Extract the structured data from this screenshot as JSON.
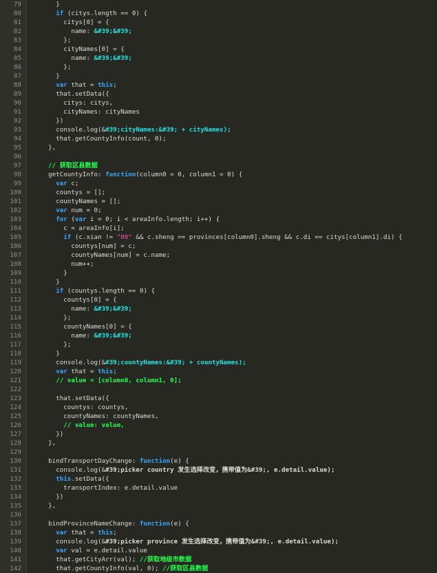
{
  "editor": {
    "colors": {
      "background": "#272822",
      "gutter": "#2f302a",
      "line_number": "#8f908a",
      "plain": "#dcdcd4",
      "keyword": "#3aa7ff",
      "string": "#1ee3e3",
      "number": "#ff4fb0",
      "comment": "#20ff4f"
    },
    "lines": [
      {
        "n": "79",
        "tokens": [
          {
            "t": "      }",
            "c": "pl"
          }
        ]
      },
      {
        "n": "80",
        "tokens": [
          {
            "t": "      ",
            "c": "pl"
          },
          {
            "t": "if",
            "c": "kw"
          },
          {
            "t": " (citys.length == 0) {",
            "c": "pl"
          }
        ]
      },
      {
        "n": "81",
        "tokens": [
          {
            "t": "        citys[0] = {",
            "c": "pl"
          }
        ]
      },
      {
        "n": "82",
        "tokens": [
          {
            "t": "          name: ",
            "c": "pl"
          },
          {
            "t": "&#39;&#39;",
            "c": "str"
          }
        ]
      },
      {
        "n": "83",
        "tokens": [
          {
            "t": "        };",
            "c": "pl"
          }
        ]
      },
      {
        "n": "84",
        "tokens": [
          {
            "t": "        cityNames[0] = {",
            "c": "pl"
          }
        ]
      },
      {
        "n": "85",
        "tokens": [
          {
            "t": "          name: ",
            "c": "pl"
          },
          {
            "t": "&#39;&#39;",
            "c": "str"
          }
        ]
      },
      {
        "n": "86",
        "tokens": [
          {
            "t": "        };",
            "c": "pl"
          }
        ]
      },
      {
        "n": "87",
        "tokens": [
          {
            "t": "      }",
            "c": "pl"
          }
        ]
      },
      {
        "n": "88",
        "tokens": [
          {
            "t": "      ",
            "c": "pl"
          },
          {
            "t": "var",
            "c": "kw"
          },
          {
            "t": " that = ",
            "c": "pl"
          },
          {
            "t": "this",
            "c": "kw"
          },
          {
            "t": ";",
            "c": "pl"
          }
        ]
      },
      {
        "n": "89",
        "tokens": [
          {
            "t": "      that.setData({",
            "c": "pl"
          }
        ]
      },
      {
        "n": "90",
        "tokens": [
          {
            "t": "        citys: citys,",
            "c": "pl"
          }
        ]
      },
      {
        "n": "91",
        "tokens": [
          {
            "t": "        cityNames: cityNames",
            "c": "pl"
          }
        ]
      },
      {
        "n": "92",
        "tokens": [
          {
            "t": "      })",
            "c": "pl"
          }
        ]
      },
      {
        "n": "93",
        "tokens": [
          {
            "t": "      console.log(&",
            "c": "pl"
          },
          {
            "t": "#39;cityNames:&#39; + cityNames);",
            "c": "str"
          }
        ]
      },
      {
        "n": "94",
        "tokens": [
          {
            "t": "      that.getCountyInfo(count, 0);",
            "c": "pl"
          }
        ]
      },
      {
        "n": "95",
        "tokens": [
          {
            "t": "    },",
            "c": "pl"
          }
        ]
      },
      {
        "n": "96",
        "tokens": [
          {
            "t": "",
            "c": "pl"
          }
        ]
      },
      {
        "n": "97",
        "tokens": [
          {
            "t": "    ",
            "c": "pl"
          },
          {
            "t": "// 获取区县数据",
            "c": "cm"
          }
        ]
      },
      {
        "n": "98",
        "tokens": [
          {
            "t": "    getCountyInfo: ",
            "c": "pl"
          },
          {
            "t": "function",
            "c": "kw"
          },
          {
            "t": "(column0 = 0, column1 = 0) {",
            "c": "pl"
          }
        ]
      },
      {
        "n": "99",
        "tokens": [
          {
            "t": "      ",
            "c": "pl"
          },
          {
            "t": "var",
            "c": "kw"
          },
          {
            "t": " c;",
            "c": "pl"
          }
        ]
      },
      {
        "n": "100",
        "tokens": [
          {
            "t": "      countys = [];",
            "c": "pl"
          }
        ]
      },
      {
        "n": "101",
        "tokens": [
          {
            "t": "      countyNames = [];",
            "c": "pl"
          }
        ]
      },
      {
        "n": "102",
        "tokens": [
          {
            "t": "      ",
            "c": "pl"
          },
          {
            "t": "var",
            "c": "kw"
          },
          {
            "t": " num = 0;",
            "c": "pl"
          }
        ]
      },
      {
        "n": "103",
        "tokens": [
          {
            "t": "      ",
            "c": "pl"
          },
          {
            "t": "for",
            "c": "kw"
          },
          {
            "t": " (",
            "c": "pl"
          },
          {
            "t": "var",
            "c": "kw"
          },
          {
            "t": " i = 0; i < areaInfo.length; i++) {",
            "c": "pl"
          }
        ]
      },
      {
        "n": "104",
        "tokens": [
          {
            "t": "        c = areaInfo[i];",
            "c": "pl"
          }
        ]
      },
      {
        "n": "105",
        "tokens": [
          {
            "t": "        ",
            "c": "pl"
          },
          {
            "t": "if",
            "c": "kw"
          },
          {
            "t": " (c.xian != ",
            "c": "pl"
          },
          {
            "t": "\"00\"",
            "c": "num"
          },
          {
            "t": " && c.sheng == provinces[column0].sheng && c.di == citys[column1].di) {",
            "c": "pl"
          }
        ]
      },
      {
        "n": "106",
        "tokens": [
          {
            "t": "          countys[num] = c;",
            "c": "pl"
          }
        ]
      },
      {
        "n": "107",
        "tokens": [
          {
            "t": "          countyNames[num] = c.name;",
            "c": "pl"
          }
        ]
      },
      {
        "n": "108",
        "tokens": [
          {
            "t": "          num++;",
            "c": "pl"
          }
        ]
      },
      {
        "n": "109",
        "tokens": [
          {
            "t": "        }",
            "c": "pl"
          }
        ]
      },
      {
        "n": "110",
        "tokens": [
          {
            "t": "      }",
            "c": "pl"
          }
        ]
      },
      {
        "n": "111",
        "tokens": [
          {
            "t": "      ",
            "c": "pl"
          },
          {
            "t": "if",
            "c": "kw"
          },
          {
            "t": " (countys.length == 0) {",
            "c": "pl"
          }
        ]
      },
      {
        "n": "112",
        "tokens": [
          {
            "t": "        countys[0] = {",
            "c": "pl"
          }
        ]
      },
      {
        "n": "113",
        "tokens": [
          {
            "t": "          name: ",
            "c": "pl"
          },
          {
            "t": "&#39;&#39;",
            "c": "str"
          }
        ]
      },
      {
        "n": "114",
        "tokens": [
          {
            "t": "        };",
            "c": "pl"
          }
        ]
      },
      {
        "n": "115",
        "tokens": [
          {
            "t": "        countyNames[0] = {",
            "c": "pl"
          }
        ]
      },
      {
        "n": "116",
        "tokens": [
          {
            "t": "          name: ",
            "c": "pl"
          },
          {
            "t": "&#39;&#39;",
            "c": "str"
          }
        ]
      },
      {
        "n": "117",
        "tokens": [
          {
            "t": "        };",
            "c": "pl"
          }
        ]
      },
      {
        "n": "118",
        "tokens": [
          {
            "t": "      }",
            "c": "pl"
          }
        ]
      },
      {
        "n": "119",
        "tokens": [
          {
            "t": "      console.log(&",
            "c": "pl"
          },
          {
            "t": "#39;countyNames:&#39; + countyNames);",
            "c": "str"
          }
        ]
      },
      {
        "n": "120",
        "tokens": [
          {
            "t": "      ",
            "c": "pl"
          },
          {
            "t": "var",
            "c": "kw"
          },
          {
            "t": " that = ",
            "c": "pl"
          },
          {
            "t": "this",
            "c": "kw"
          },
          {
            "t": ";",
            "c": "pl"
          }
        ]
      },
      {
        "n": "121",
        "tokens": [
          {
            "t": "      ",
            "c": "pl"
          },
          {
            "t": "// value = [column0, column1, 0];",
            "c": "cm"
          }
        ]
      },
      {
        "n": "122",
        "tokens": [
          {
            "t": "",
            "c": "pl"
          }
        ]
      },
      {
        "n": "123",
        "tokens": [
          {
            "t": "      that.setData({",
            "c": "pl"
          }
        ]
      },
      {
        "n": "124",
        "tokens": [
          {
            "t": "        countys: countys,",
            "c": "pl"
          }
        ]
      },
      {
        "n": "125",
        "tokens": [
          {
            "t": "        countyNames: countyNames,",
            "c": "pl"
          }
        ]
      },
      {
        "n": "126",
        "tokens": [
          {
            "t": "        ",
            "c": "pl"
          },
          {
            "t": "// value: value,",
            "c": "cm"
          }
        ]
      },
      {
        "n": "127",
        "tokens": [
          {
            "t": "      })",
            "c": "pl"
          }
        ]
      },
      {
        "n": "128",
        "tokens": [
          {
            "t": "    },",
            "c": "pl"
          }
        ]
      },
      {
        "n": "129",
        "tokens": [
          {
            "t": "",
            "c": "pl"
          }
        ]
      },
      {
        "n": "130",
        "tokens": [
          {
            "t": "    bindTransportDayChange: ",
            "c": "pl"
          },
          {
            "t": "function",
            "c": "kw"
          },
          {
            "t": "(e) {",
            "c": "pl"
          }
        ]
      },
      {
        "n": "131",
        "tokens": [
          {
            "t": "      console.log(&",
            "c": "pl"
          },
          {
            "t": "#39;picker country 发生选择改变，携带值为&#39;, e.detail.value);",
            "c": "bl"
          }
        ]
      },
      {
        "n": "132",
        "tokens": [
          {
            "t": "      ",
            "c": "pl"
          },
          {
            "t": "this",
            "c": "kw"
          },
          {
            "t": ".setData({",
            "c": "pl"
          }
        ]
      },
      {
        "n": "133",
        "tokens": [
          {
            "t": "        transportIndex: e.detail.value",
            "c": "pl"
          }
        ]
      },
      {
        "n": "134",
        "tokens": [
          {
            "t": "      })",
            "c": "pl"
          }
        ]
      },
      {
        "n": "135",
        "tokens": [
          {
            "t": "    },",
            "c": "pl"
          }
        ]
      },
      {
        "n": "136",
        "tokens": [
          {
            "t": "",
            "c": "pl"
          }
        ]
      },
      {
        "n": "137",
        "tokens": [
          {
            "t": "    bindProvinceNameChange: ",
            "c": "pl"
          },
          {
            "t": "function",
            "c": "kw"
          },
          {
            "t": "(e) {",
            "c": "pl"
          }
        ]
      },
      {
        "n": "138",
        "tokens": [
          {
            "t": "      ",
            "c": "pl"
          },
          {
            "t": "var",
            "c": "kw"
          },
          {
            "t": " that = ",
            "c": "pl"
          },
          {
            "t": "this",
            "c": "kw"
          },
          {
            "t": ";",
            "c": "pl"
          }
        ]
      },
      {
        "n": "139",
        "tokens": [
          {
            "t": "      console.log(&",
            "c": "pl"
          },
          {
            "t": "#39;picker province 发生选择改变，携带值为&#39;, e.detail.value);",
            "c": "bl"
          }
        ]
      },
      {
        "n": "140",
        "tokens": [
          {
            "t": "      ",
            "c": "pl"
          },
          {
            "t": "var",
            "c": "kw"
          },
          {
            "t": " val = e.detail.value",
            "c": "pl"
          }
        ]
      },
      {
        "n": "141",
        "tokens": [
          {
            "t": "      that.getCityArr(val); ",
            "c": "pl"
          },
          {
            "t": "//获取地级市数据",
            "c": "cm"
          }
        ]
      },
      {
        "n": "142",
        "tokens": [
          {
            "t": "      that.getCountyInfo(val, 0); ",
            "c": "pl"
          },
          {
            "t": "//获取区县数据",
            "c": "cm"
          }
        ]
      }
    ]
  }
}
